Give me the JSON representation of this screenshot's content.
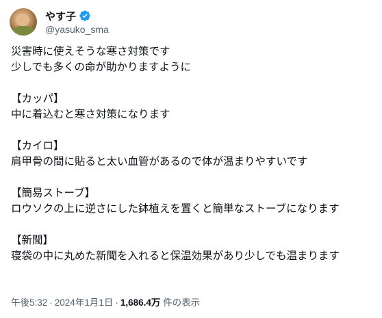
{
  "author": {
    "display_name": "やす子",
    "handle": "@yasuko_sma",
    "avatar_icon": "user-avatar",
    "verified_icon": "verified-badge-icon",
    "verified_color": "#1d9bf0"
  },
  "tweet": {
    "lines": [
      "災害時に使えそうな寒さ対策です",
      "少しでも多くの命が助かりますように",
      "",
      "【カッパ】",
      "中に着込むと寒さ対策になります",
      "",
      "【カイロ】",
      "肩甲骨の間に貼ると太い血管があるので体が温まりやすいです",
      "",
      "【簡易ストーブ】",
      "ロウソクの上に逆さにした鉢植えを置くと簡単なストーブになります",
      "",
      "【新聞】",
      "寝袋の中に丸めた新聞を入れると保温効果があり少しでも温まります"
    ]
  },
  "meta": {
    "time": "午後5:32",
    "separator": "·",
    "date": "2024年1月1日",
    "views_count": "1,686.4万",
    "views_label": " 件の表示"
  }
}
